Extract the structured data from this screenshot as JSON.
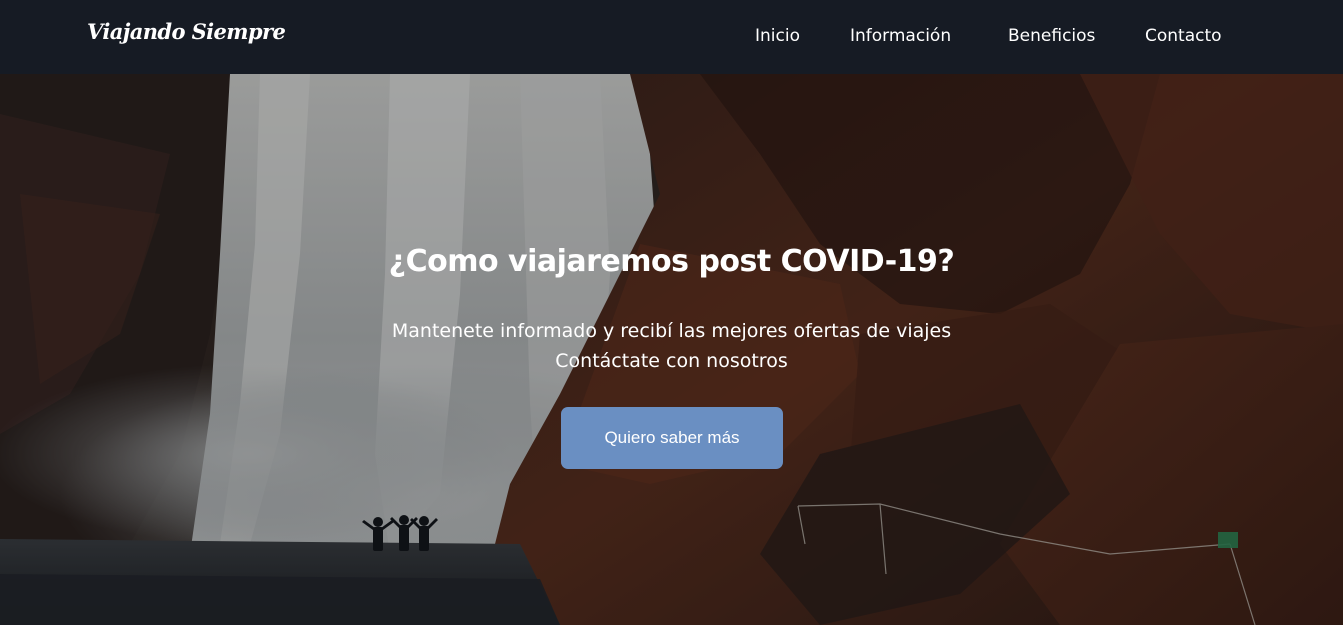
{
  "header": {
    "brand": "Viajando Siempre",
    "nav": [
      "Inicio",
      "Información",
      "Beneficios",
      "Contacto"
    ]
  },
  "hero": {
    "title": "¿Como viajaremos post COVID-19?",
    "subtitle_line_1": "Mantenete informado y recibí las mejores ofertas de viajes",
    "subtitle_line_2": "Contáctate con nosotros",
    "cta_label": "Quiero saber más",
    "background": "waterfall photo"
  },
  "colors": {
    "header_bg": "#161b24",
    "cta_bg": "#6a8fc2",
    "text": "#ffffff"
  }
}
